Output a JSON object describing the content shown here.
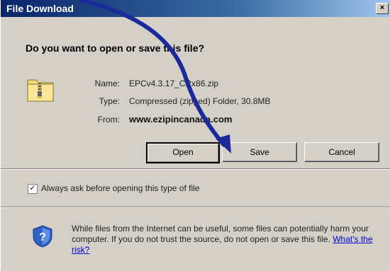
{
  "title_bar": {
    "title": "File Download",
    "close_label": "×"
  },
  "prompt": {
    "question": "Do you want to open or save this file?"
  },
  "file": {
    "icon": "zip-folder-icon",
    "name_label": "Name:",
    "name_value": "EPCv4.3.17_CRx86.zip",
    "type_label": "Type:",
    "type_value": "Compressed (zipped) Folder, 30.8MB",
    "from_label": "From:",
    "from_value": "www.ezipincanada.com"
  },
  "buttons": {
    "open": "Open",
    "save": "Save",
    "cancel": "Cancel"
  },
  "checkbox": {
    "checked": true,
    "mark": "✓",
    "label": "Always ask before opening this type of file"
  },
  "warning": {
    "icon": "security-shield-icon",
    "text": "While files from the Internet can be useful, some files can potentially harm your computer. If you do not trust the source, do not open or save this file.",
    "link": "What's the risk?"
  },
  "annotation": {
    "arrow_color": "#1a2a9a"
  }
}
